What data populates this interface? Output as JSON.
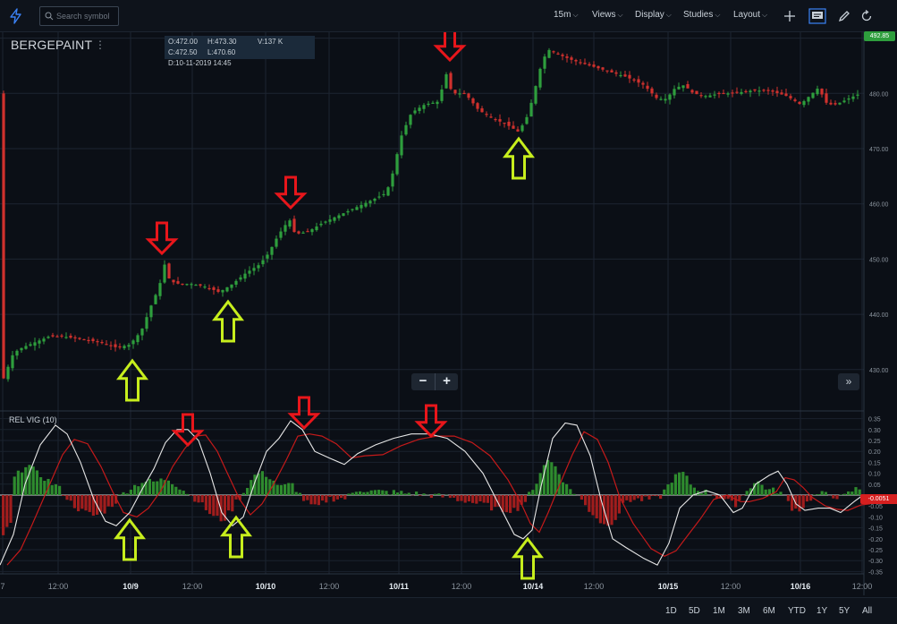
{
  "toolbar": {
    "search_placeholder": "Search symbol",
    "interval": "15m",
    "views": "Views",
    "display": "Display",
    "studies": "Studies",
    "layout": "Layout"
  },
  "symbol": {
    "name": "BERGEPAINT"
  },
  "ohlc": {
    "open": "O:472.00",
    "high": "H:473.30",
    "volume": "V:137 K",
    "close": "C:472.50",
    "low": "L:470.60",
    "date": "D:10-11-2019 14:45"
  },
  "price_axis": {
    "last_price": "492.85",
    "ticks": [
      "490.00",
      "480.00",
      "470.00",
      "460.00",
      "450.00",
      "440.00",
      "430.00"
    ]
  },
  "indicator": {
    "label": "REL VIG (10)",
    "last_value": "-0.0051",
    "ticks": [
      "0.35",
      "0.30",
      "0.25",
      "0.20",
      "0.15",
      "0.10",
      "0.05",
      "-0.05",
      "-0.10",
      "-0.15",
      "-0.20",
      "-0.25",
      "-0.30",
      "-0.35"
    ]
  },
  "time_axis": {
    "labels": [
      "7",
      "12:00",
      "10/9",
      "12:00",
      "10/10",
      "12:00",
      "10/11",
      "12:00",
      "10/14",
      "12:00",
      "10/15",
      "12:00",
      "10/16",
      "12:00"
    ]
  },
  "zoom": {
    "minus": "−",
    "plus": "+"
  },
  "forward_icon": "»",
  "ranges": [
    "1D",
    "5D",
    "1M",
    "3M",
    "6M",
    "YTD",
    "1Y",
    "5Y",
    "All"
  ],
  "colors": {
    "background": "#0b0f16",
    "up": "#2e9e3d",
    "down": "#d0312d",
    "sell_arrow": "#e8161b",
    "buy_arrow": "#c7ee1d",
    "vig_line": "#e6e6e6",
    "signal_line": "#c41a1a"
  },
  "icons": [
    "lightning-icon",
    "search-icon",
    "crosshair-icon",
    "comment-icon",
    "pencil-icon",
    "refresh-icon"
  ]
}
